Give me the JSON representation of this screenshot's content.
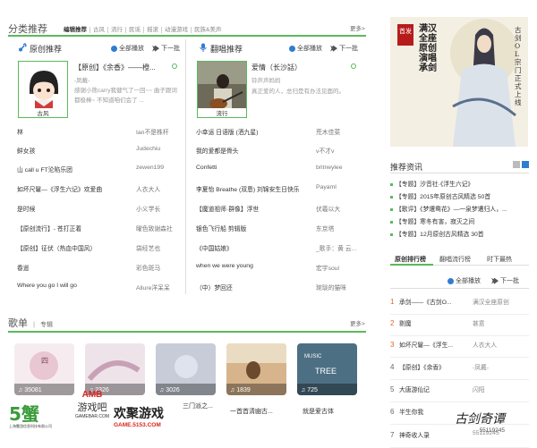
{
  "left": {
    "title": "分类推荐",
    "tabs": [
      "编辑推荐",
      "古风",
      "流行",
      "民谣",
      "摇滚",
      "动漫游戏",
      "民族&美声"
    ],
    "more": "更多>",
    "original": {
      "title": "原创推荐",
      "play_all": "全部播放",
      "next": "下一批",
      "avatar_tag": "古风",
      "feature_title": "【原创】《余香》——橙...",
      "feature_sub1": "-凤戴-",
      "feature_desc": "感谢小熊carry我健气了一回~~ 曲子跟词都极棒~ 不知道咱们会了 ...",
      "songs": [
        {
          "title": "林",
          "artist": "Ian不是株杆"
        },
        {
          "title": "鲜女孩",
          "artist": "Judechiu"
        },
        {
          "title": "山 call u FT沦陷乐团",
          "artist": "zewen199"
        },
        {
          "title": "如坏尺鬘—《浮生六记》欢爱曲",
          "artist": "人衣大人"
        },
        {
          "title": "是时候",
          "artist": "小义学长"
        },
        {
          "title": "【原创流行】- 苍打正着",
          "artist": "曜色致谢森社"
        },
        {
          "title": "【原创】征伏（热血中国风）",
          "artist": "袋经艺也"
        },
        {
          "title": "春遥",
          "artist": "彩色斑马"
        },
        {
          "title": "Where you go I will go",
          "artist": "Allure洋呆呆"
        }
      ]
    },
    "cover": {
      "title": "翻唱推荐",
      "play_all": "全部播放",
      "next": "下一批",
      "avatar_tag": "流行",
      "feature_title": "爱情（长沙話）",
      "feature_sub1": "铃声声妈妈",
      "feature_desc": "真正爱的人，总归是有办法见面的。",
      "songs": [
        {
          "title": "小幸运 日语版 (洒九星)",
          "artist": "荒木佳菜"
        },
        {
          "title": "我的爱都是骨头",
          "artist": "v不才v"
        },
        {
          "title": "Confetti",
          "artist": "britneylee"
        },
        {
          "title": "李夏怡 Breathe (双恩) 刘锦安生日快乐",
          "artist": "PayamI"
        },
        {
          "title": "【魔道祖师·群像】浮世",
          "artist": "伏羲以大"
        },
        {
          "title": "银色飞行船 剪辑版",
          "artist": "东京塔"
        },
        {
          "title": "《中国姑娘》",
          "artist": "_歌手：黄 云..."
        },
        {
          "title": "when we were young",
          "artist": "宏宇soul"
        },
        {
          "title": "（中）梦回还",
          "artist": "琬琰的猫咪"
        }
      ]
    }
  },
  "songlist": {
    "title": "歌单",
    "sub": "专辑",
    "more": "更多>",
    "items": [
      {
        "count": "35081",
        "caption": ""
      },
      {
        "count": "2326",
        "caption": ""
      },
      {
        "count": "3026",
        "caption": "三门派之..."
      },
      {
        "count": "1839",
        "caption": "一首首清幽古..."
      },
      {
        "count": "725",
        "caption": "就是爱古体"
      }
    ]
  },
  "right": {
    "news_title": "推荐资讯",
    "news": [
      "【专题】汐音社·《浮生六记》",
      "【专题】2015年原创古风精选 50首",
      "【歌评】《梦遭鸯花》—一泉梦遭归人，...",
      "【专题】寒冬有害，寂灭之间",
      "【专题】12月原创古风精选 30首"
    ],
    "rank_tabs": [
      "原创排行榜",
      "翻唱流行榜",
      "时下最热"
    ],
    "play_all": "全部播放",
    "next": "下一批",
    "rank": [
      {
        "num": "1",
        "title": "承剑——《古剑O...",
        "artist": "满汉全座原创"
      },
      {
        "num": "2",
        "title": "剔魔",
        "artist": "甚意"
      },
      {
        "num": "3",
        "title": "如坏尺鬘—《浮生...",
        "artist": "人衣大人"
      },
      {
        "num": "4",
        "title": "【原创】《余香》",
        "artist": "-凤戴-"
      },
      {
        "num": "5",
        "title": "大唐游仙记",
        "artist": "闪阳"
      },
      {
        "num": "6",
        "title": "半生你我",
        "artist": ""
      },
      {
        "num": "7",
        "title": "神奇收人录",
        "artist": "55119245"
      }
    ],
    "poster_text": "满汉全座原创演唱 承剑",
    "poster_small": "首发",
    "poster_side": "古剑OL宗门正式上线"
  },
  "watermarks": {
    "logo1": "5蟹",
    "game_bar": "游戏吧",
    "game_bar_site": "GAMEBAR.COM",
    "game5153": "欢聚游戏",
    "game5153_site": "GAME.5153.COM",
    "gujian": "古剑奇谭",
    "gujian_num": "55119245"
  }
}
